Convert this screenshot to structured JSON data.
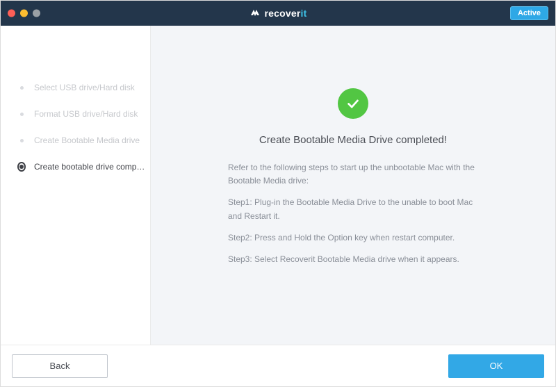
{
  "header": {
    "brand_prefix": "recover",
    "brand_suffix": "it",
    "active_badge": "Active"
  },
  "sidebar": {
    "items": [
      {
        "label": "Select USB drive/Hard disk",
        "active": false
      },
      {
        "label": "Format USB drive/Hard disk",
        "active": false
      },
      {
        "label": "Create Bootable Media drive",
        "active": false
      },
      {
        "label": "Create bootable drive compl...",
        "active": true
      }
    ]
  },
  "content": {
    "title": "Create Bootable Media Drive completed!",
    "intro": "Refer to the following steps to start up the unbootable Mac with the Bootable Media drive:",
    "step1": "Step1: Plug-in the Bootable Media Drive to the unable to boot Mac and Restart it.",
    "step2": "Step2: Press and Hold the Option key when restart computer.",
    "step3": "Step3: Select Recoverit Bootable Media drive when it appears."
  },
  "footer": {
    "back_label": "Back",
    "ok_label": "OK"
  },
  "colors": {
    "accent": "#32a8e6",
    "success": "#52c643"
  }
}
